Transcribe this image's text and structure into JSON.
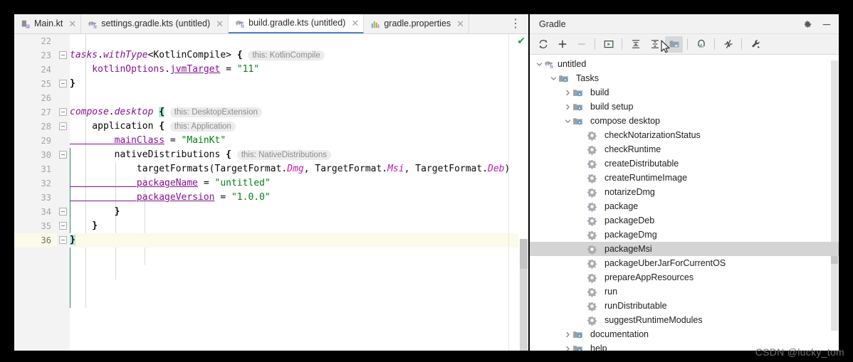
{
  "editor": {
    "tabs": [
      {
        "label": "Main.kt",
        "icon": "kotlin-file-icon",
        "active": false,
        "closable": true
      },
      {
        "label": "settings.gradle.kts (untitled)",
        "icon": "gradle-elephant-icon",
        "active": false,
        "closable": true
      },
      {
        "label": "build.gradle.kts (untitled)",
        "icon": "gradle-elephant-icon",
        "active": true,
        "closable": true
      },
      {
        "label": "gradle.properties",
        "icon": "properties-file-icon",
        "active": false,
        "closable": true
      }
    ],
    "tab_overflow_label": "⋮",
    "first_line_number": 22,
    "current_line_number": 36,
    "inspection_status": "✔",
    "lines": [
      {
        "n": 22,
        "segments": []
      },
      {
        "n": 23,
        "indent": 0,
        "segments": [
          {
            "t": "tasks",
            "c": "field"
          },
          {
            "t": ".",
            "c": "ident"
          },
          {
            "t": "withType",
            "c": "field"
          },
          {
            "t": "<KotlinCompile> ",
            "c": "ident"
          },
          {
            "t": "{",
            "c": "brace"
          },
          {
            "t": " ",
            "c": "ident"
          },
          {
            "t": "this: KotlinCompile",
            "c": "hint"
          }
        ]
      },
      {
        "n": 24,
        "indent": 0,
        "segments": [
          {
            "t": "    kotlinOptions",
            "c": "prop"
          },
          {
            "t": ".",
            "c": "ident"
          },
          {
            "t": "jvmTarget",
            "c": "propu"
          },
          {
            "t": " = ",
            "c": "ident"
          },
          {
            "t": "\"11\"",
            "c": "str"
          }
        ]
      },
      {
        "n": 25,
        "indent": 0,
        "segments": [
          {
            "t": "}",
            "c": "brace"
          }
        ]
      },
      {
        "n": 26,
        "segments": []
      },
      {
        "n": 27,
        "indent": 0,
        "segments": [
          {
            "t": "compose",
            "c": "field"
          },
          {
            "t": ".",
            "c": "ident"
          },
          {
            "t": "desktop",
            "c": "field"
          },
          {
            "t": " ",
            "c": "ident"
          },
          {
            "t": "{",
            "c": "brace-hl"
          },
          {
            "t": " ",
            "c": "ident"
          },
          {
            "t": "this: DesktopExtension",
            "c": "hint"
          }
        ]
      },
      {
        "n": 28,
        "indent": 0,
        "segments": [
          {
            "t": "    application ",
            "c": "ident"
          },
          {
            "t": "{",
            "c": "brace"
          },
          {
            "t": " ",
            "c": "ident"
          },
          {
            "t": "this: Application",
            "c": "hint"
          }
        ]
      },
      {
        "n": 29,
        "indent": 0,
        "segments": [
          {
            "t": "        mainClass",
            "c": "propu"
          },
          {
            "t": " = ",
            "c": "ident"
          },
          {
            "t": "\"MainKt\"",
            "c": "str"
          }
        ]
      },
      {
        "n": 30,
        "indent": 0,
        "segments": [
          {
            "t": "        nativeDistributions ",
            "c": "ident"
          },
          {
            "t": "{",
            "c": "brace"
          },
          {
            "t": " ",
            "c": "ident"
          },
          {
            "t": "this: NativeDistributions",
            "c": "hint"
          }
        ]
      },
      {
        "n": 31,
        "indent": 0,
        "segments": [
          {
            "t": "            targetFormats(TargetFormat.",
            "c": "ident"
          },
          {
            "t": "Dmg",
            "c": "enm"
          },
          {
            "t": ", TargetFormat.",
            "c": "ident"
          },
          {
            "t": "Msi",
            "c": "enm"
          },
          {
            "t": ", TargetFormat.",
            "c": "ident"
          },
          {
            "t": "Deb",
            "c": "enm"
          },
          {
            "t": ")",
            "c": "ident"
          }
        ]
      },
      {
        "n": 32,
        "indent": 0,
        "segments": [
          {
            "t": "            packageName",
            "c": "propu"
          },
          {
            "t": " = ",
            "c": "ident"
          },
          {
            "t": "\"untitled\"",
            "c": "str"
          }
        ]
      },
      {
        "n": 33,
        "indent": 0,
        "segments": [
          {
            "t": "            packageVersion",
            "c": "propu"
          },
          {
            "t": " = ",
            "c": "ident"
          },
          {
            "t": "\"1.0.0\"",
            "c": "str"
          }
        ]
      },
      {
        "n": 34,
        "indent": 0,
        "segments": [
          {
            "t": "        }",
            "c": "brace"
          }
        ]
      },
      {
        "n": 35,
        "indent": 0,
        "segments": [
          {
            "t": "    }",
            "c": "brace"
          }
        ]
      },
      {
        "n": 36,
        "indent": 0,
        "current": true,
        "segments": [
          {
            "t": "}",
            "c": "brace-hl"
          }
        ]
      }
    ]
  },
  "gradle": {
    "title": "Gradle",
    "header_actions": [
      {
        "name": "settings-gear-icon",
        "glyph": "gear"
      },
      {
        "name": "hide-minimize-icon",
        "glyph": "minus"
      }
    ],
    "toolbar": [
      {
        "name": "refresh-icon",
        "tip": "Reload All Gradle Projects"
      },
      {
        "name": "add-icon",
        "tip": "Link Gradle Project"
      },
      {
        "name": "remove-icon",
        "tip": "Detach Gradle Project",
        "disabled": true
      },
      {
        "name": "separator"
      },
      {
        "name": "run-task-icon",
        "tip": "Run Task"
      },
      {
        "name": "separator"
      },
      {
        "name": "expand-all-icon",
        "tip": "Expand All"
      },
      {
        "name": "collapse-all-icon",
        "tip": "Collapse All"
      },
      {
        "name": "show-tasks-grouped-icon",
        "tip": "Group Tasks",
        "pressed": true
      },
      {
        "name": "separator"
      },
      {
        "name": "analyze-dependencies-icon",
        "tip": "Analyze Dependencies"
      },
      {
        "name": "separator"
      },
      {
        "name": "toggle-offline-icon",
        "tip": "Toggle Offline Mode"
      },
      {
        "name": "separator"
      },
      {
        "name": "build-tool-settings-icon",
        "tip": "Build Tool Settings"
      }
    ],
    "tree": [
      {
        "label": "untitled",
        "depth": 0,
        "toggle": "expanded",
        "icon": "gradle-elephant-icon"
      },
      {
        "label": "Tasks",
        "depth": 1,
        "toggle": "expanded",
        "icon": "task-folder-icon"
      },
      {
        "label": "build",
        "depth": 2,
        "toggle": "collapsed",
        "icon": "task-folder-icon"
      },
      {
        "label": "build setup",
        "depth": 2,
        "toggle": "collapsed",
        "icon": "task-folder-icon"
      },
      {
        "label": "compose desktop",
        "depth": 2,
        "toggle": "expanded",
        "icon": "task-folder-icon"
      },
      {
        "label": "checkNotarizationStatus",
        "depth": 3,
        "toggle": "none",
        "icon": "gear-task-icon"
      },
      {
        "label": "checkRuntime",
        "depth": 3,
        "toggle": "none",
        "icon": "gear-task-icon"
      },
      {
        "label": "createDistributable",
        "depth": 3,
        "toggle": "none",
        "icon": "gear-task-icon"
      },
      {
        "label": "createRuntimeImage",
        "depth": 3,
        "toggle": "none",
        "icon": "gear-task-icon"
      },
      {
        "label": "notarizeDmg",
        "depth": 3,
        "toggle": "none",
        "icon": "gear-task-icon"
      },
      {
        "label": "package",
        "depth": 3,
        "toggle": "none",
        "icon": "gear-task-icon"
      },
      {
        "label": "packageDeb",
        "depth": 3,
        "toggle": "none",
        "icon": "gear-task-icon"
      },
      {
        "label": "packageDmg",
        "depth": 3,
        "toggle": "none",
        "icon": "gear-task-icon"
      },
      {
        "label": "packageMsi",
        "depth": 3,
        "toggle": "none",
        "icon": "gear-task-icon",
        "selected": true
      },
      {
        "label": "packageUberJarForCurrentOS",
        "depth": 3,
        "toggle": "none",
        "icon": "gear-task-icon"
      },
      {
        "label": "prepareAppResources",
        "depth": 3,
        "toggle": "none",
        "icon": "gear-task-icon"
      },
      {
        "label": "run",
        "depth": 3,
        "toggle": "none",
        "icon": "gear-task-icon"
      },
      {
        "label": "runDistributable",
        "depth": 3,
        "toggle": "none",
        "icon": "gear-task-icon"
      },
      {
        "label": "suggestRuntimeModules",
        "depth": 3,
        "toggle": "none",
        "icon": "gear-task-icon"
      },
      {
        "label": "documentation",
        "depth": 2,
        "toggle": "collapsed",
        "icon": "task-folder-icon"
      },
      {
        "label": "help",
        "depth": 2,
        "toggle": "collapsed",
        "icon": "task-folder-icon"
      }
    ]
  },
  "watermark": "CSDN @lucky_tom",
  "colors": {
    "selection": "#d4d4d4",
    "current_line": "#fcfae8",
    "accent_blue": "#4a88c7",
    "string_green": "#067d17",
    "keyword_purple": "#871094",
    "enum_magenta": "#c518b0",
    "checkmark_green": "#1f9c3f"
  }
}
